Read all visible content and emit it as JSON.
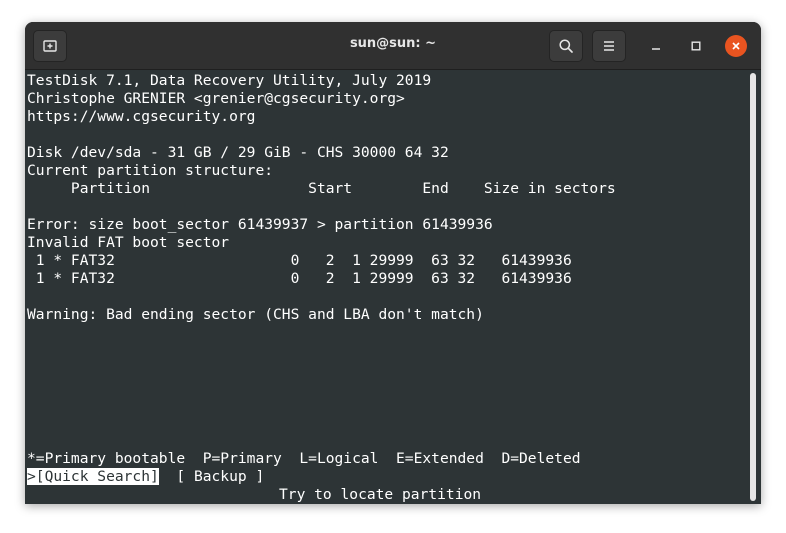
{
  "window": {
    "title": "sun@sun: ~"
  },
  "icons": {
    "new_tab": "new-tab-icon",
    "search": "search-icon",
    "menu": "hamburger-menu-icon",
    "minimize": "minimize-icon",
    "maximize": "maximize-icon",
    "close": "close-icon"
  },
  "colors": {
    "terminal_bg": "#2d3436",
    "terminal_fg": "#ffffff",
    "close_button": "#e95420",
    "headerbar": "#303030"
  },
  "terminal": {
    "header_lines": [
      "TestDisk 7.1, Data Recovery Utility, July 2019",
      "Christophe GRENIER <grenier@cgsecurity.org>",
      "https://www.cgsecurity.org"
    ],
    "disk_line": "Disk /dev/sda - 31 GB / 29 GiB - CHS 30000 64 32",
    "structure_label": "Current partition structure:",
    "columns_header": "     Partition                  Start        End    Size in sectors",
    "error_line": "Error: size boot_sector 61439937 > partition 61439936",
    "invalid_line": "Invalid FAT boot sector",
    "partitions": [
      " 1 * FAT32                    0   2  1 29999  63 32   61439936",
      " 1 * FAT32                    0   2  1 29999  63 32   61439936"
    ],
    "warning_line": "Warning: Bad ending sector (CHS and LBA don't match)",
    "legend_line": "*=Primary bootable  P=Primary  L=Logical  E=Extended  D=Deleted",
    "menu": {
      "quick_search": ">[Quick Search]",
      "backup": "[ Backup ]"
    },
    "hint_line": "Try to locate partition"
  }
}
